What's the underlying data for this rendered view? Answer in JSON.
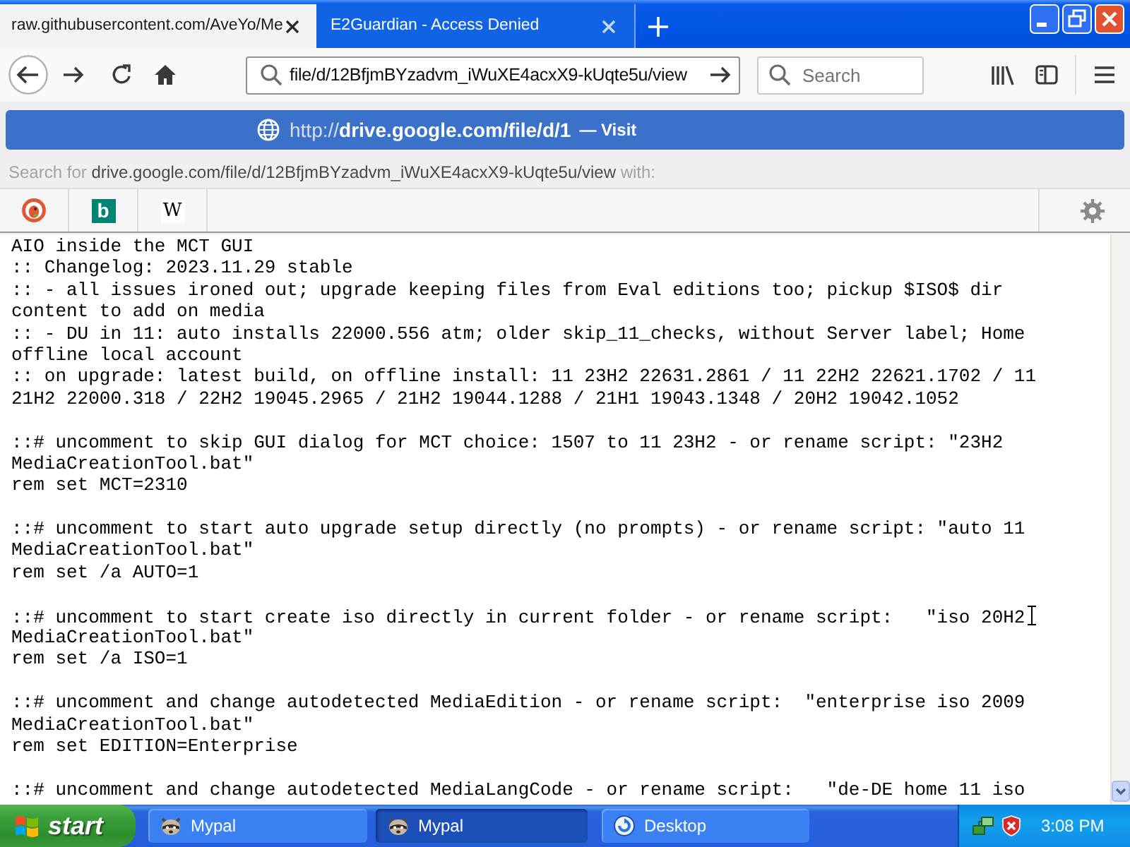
{
  "tabs": [
    {
      "title": "raw.githubusercontent.com/AveYo/Me",
      "selected": true
    },
    {
      "title": "E2Guardian - Access Denied",
      "selected": false
    }
  ],
  "toolbar": {
    "url": "file/d/12BfjmBYzadvm_iWuXE4acxX9-kUqte5u/view",
    "search": {
      "placeholder": "Search"
    }
  },
  "url_popup": {
    "suggestion": {
      "url": "http://**drive.google.com/file/d/1**",
      "action": "— Visit"
    },
    "search_for": {
      "label": "Search for",
      "query": "drive.google.com/file/d/12BfjmBYzadvm_iWuXE4acxX9-kUqte5u/view",
      "suffix": "with:"
    },
    "engines": [
      {
        "kind": "duck"
      },
      {
        "kind": "tile",
        "glyph": "b"
      },
      {
        "kind": "letter",
        "glyph": "W"
      }
    ]
  },
  "page": {
    "blocks": [
      [
        "AIO inside the MCT GUI",
        ":: Changelog: 2023.11.29 stable",
        ":: - all issues ironed out; upgrade keeping files from Eval editions too; pickup $ISO$ dir",
        "content to add on media",
        ":: - DU in 11: auto installs 22000.556 atm; older skip_11_checks, without Server label; Home",
        "offline local account",
        ":: on upgrade: latest build, on offline install: 11 23H2 22631.2861 / 11 22H2 22621.1702 / 11",
        "21H2 22000.318 / 22H2 19045.2965 / 21H2 19044.1288 / 21H1 19043.1348 / 20H2 19042.1052"
      ],
      [
        "::# uncomment to skip GUI dialog for MCT choice: 1507 to 11 23H2 - or rename script: \"23H2",
        "MediaCreationTool.bat\"",
        "rem set MCT=2310"
      ],
      [
        "::# uncomment to start auto upgrade setup directly (no prompts) - or rename script: \"auto 11",
        "MediaCreationTool.bat\"",
        "rem set /a AUTO=1"
      ],
      [
        "::# uncomment to start create iso directly in current folder - or rename script:   \"iso 20H2",
        "MediaCreationTool.bat\"",
        "rem set /a ISO=1"
      ],
      [
        "::# uncomment and change autodetected MediaEdition - or rename script:  \"enterprise iso 2009",
        "MediaCreationTool.bat\"",
        "rem set EDITION=Enterprise"
      ],
      [
        "::# uncomment and change autodetected MediaLangCode - or rename script:   \"de-DE home 11 iso"
      ]
    ]
  },
  "taskbar": {
    "start": "start",
    "tasks": [
      {
        "kind": "browser",
        "label": "Mypal",
        "selected": false
      },
      {
        "kind": "browser",
        "label": "Mypal",
        "selected": true
      },
      {
        "kind": "desktop",
        "label": "Desktop",
        "selected": false
      }
    ],
    "clock": "3:08 PM"
  }
}
